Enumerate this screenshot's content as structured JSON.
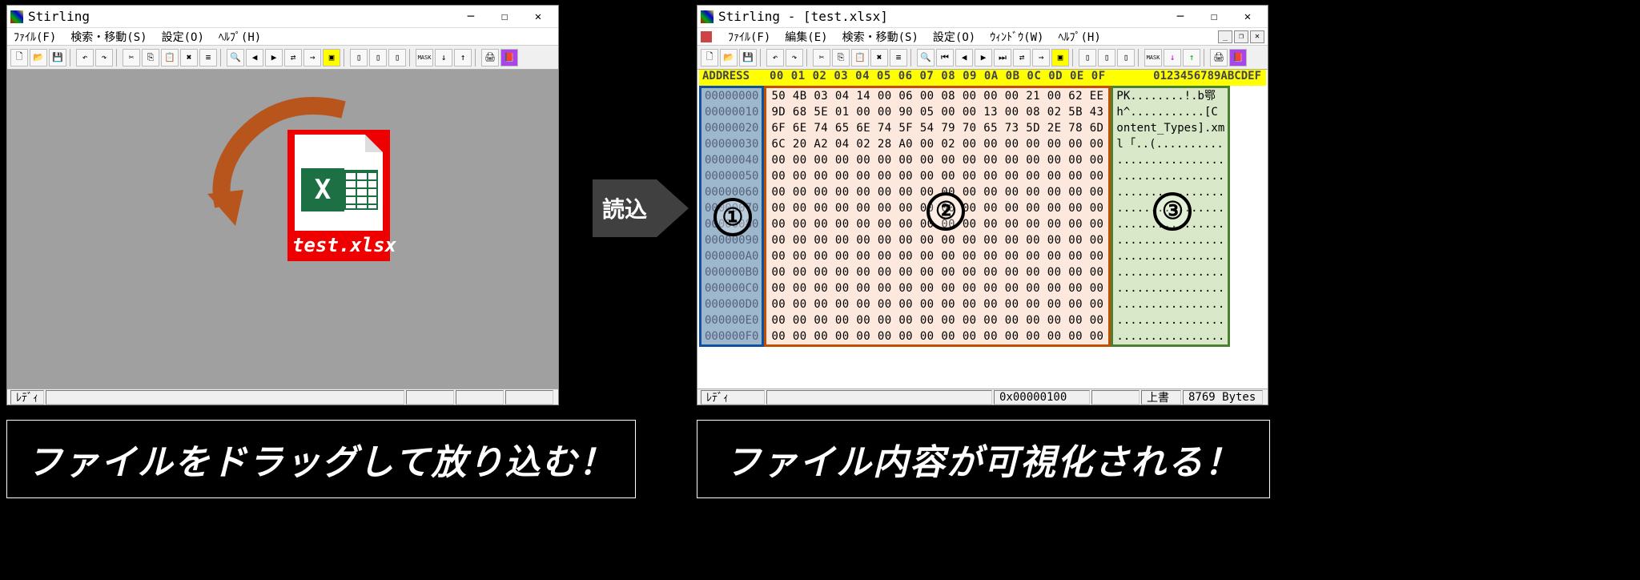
{
  "window_left": {
    "title": "Stirling",
    "menus": [
      "ﾌｧｲﾙ(F)",
      "検索・移動(S)",
      "設定(O)",
      "ﾍﾙﾌﾟ(H)"
    ],
    "status": "ﾚﾃﾞｨ",
    "drop_file": "test.xlsx"
  },
  "window_right": {
    "title": "Stirling - [test.xlsx]",
    "menus": [
      "ﾌｧｲﾙ(F)",
      "編集(E)",
      "検索・移動(S)",
      "設定(O)",
      "ｳｨﾝﾄﾞｳ(W)",
      "ﾍﾙﾌﾟ(H)"
    ],
    "status": "ﾚﾃﾞｨ",
    "status_addr": "0x00000100",
    "status_mode": "上書",
    "status_size": "8769 Bytes",
    "header_addr": "ADDRESS",
    "header_hex": "00 01 02 03 04 05 06 07 08 09 0A 0B 0C 0D 0E 0F",
    "header_ascii": "0123456789ABCDEF",
    "rows": [
      {
        "a": "00000000",
        "h": "50 4B 03 04 14 00 06 00 08 00 00 00 21 00 62 EE",
        "s": "PK........!.b鄂"
      },
      {
        "a": "00000010",
        "h": "9D 68 5E 01 00 00 90 05 00 00 13 00 08 02 5B 43",
        "s": " h^...........[C"
      },
      {
        "a": "00000020",
        "h": "6F 6E 74 65 6E 74 5F 54 79 70 65 73 5D 2E 78 6D",
        "s": "ontent_Types].xm"
      },
      {
        "a": "00000030",
        "h": "6C 20 A2 04 02 28 A0 00 02 00 00 00 00 00 00 00",
        "s": "l ｢..(.........."
      },
      {
        "a": "00000040",
        "h": "00 00 00 00 00 00 00 00 00 00 00 00 00 00 00 00",
        "s": "................"
      },
      {
        "a": "00000050",
        "h": "00 00 00 00 00 00 00 00 00 00 00 00 00 00 00 00",
        "s": "................"
      },
      {
        "a": "00000060",
        "h": "00 00 00 00 00 00 00 00 00 00 00 00 00 00 00 00",
        "s": "................"
      },
      {
        "a": "00000070",
        "h": "00 00 00 00 00 00 00 00 00 00 00 00 00 00 00 00",
        "s": "................"
      },
      {
        "a": "00000080",
        "h": "00 00 00 00 00 00 00 00 00 00 00 00 00 00 00 00",
        "s": "................"
      },
      {
        "a": "00000090",
        "h": "00 00 00 00 00 00 00 00 00 00 00 00 00 00 00 00",
        "s": "................"
      },
      {
        "a": "000000A0",
        "h": "00 00 00 00 00 00 00 00 00 00 00 00 00 00 00 00",
        "s": "................"
      },
      {
        "a": "000000B0",
        "h": "00 00 00 00 00 00 00 00 00 00 00 00 00 00 00 00",
        "s": "................"
      },
      {
        "a": "000000C0",
        "h": "00 00 00 00 00 00 00 00 00 00 00 00 00 00 00 00",
        "s": "................"
      },
      {
        "a": "000000D0",
        "h": "00 00 00 00 00 00 00 00 00 00 00 00 00 00 00 00",
        "s": "................"
      },
      {
        "a": "000000E0",
        "h": "00 00 00 00 00 00 00 00 00 00 00 00 00 00 00 00",
        "s": "................"
      },
      {
        "a": "000000F0",
        "h": "00 00 00 00 00 00 00 00 00 00 00 00 00 00 00 00",
        "s": "................"
      }
    ]
  },
  "labels": {
    "load": "読込",
    "badge1": "①",
    "badge2": "②",
    "badge3": "③",
    "caption_left": "ファイルをドラッグして放り込む！",
    "caption_right": "ファイル内容が可視化される！"
  }
}
